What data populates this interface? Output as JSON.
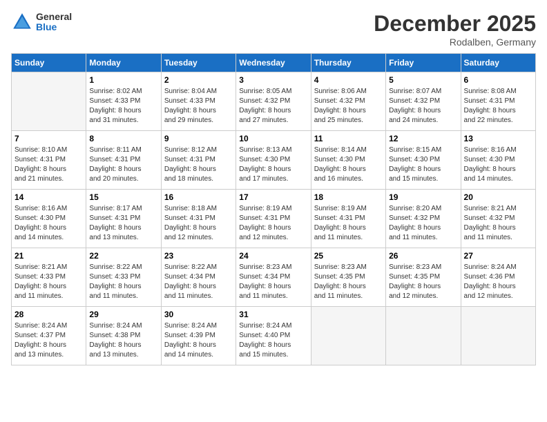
{
  "header": {
    "logo_general": "General",
    "logo_blue": "Blue",
    "month_title": "December 2025",
    "location": "Rodalben, Germany"
  },
  "days_of_week": [
    "Sunday",
    "Monday",
    "Tuesday",
    "Wednesday",
    "Thursday",
    "Friday",
    "Saturday"
  ],
  "weeks": [
    [
      {
        "day": "",
        "info": ""
      },
      {
        "day": "1",
        "info": "Sunrise: 8:02 AM\nSunset: 4:33 PM\nDaylight: 8 hours\nand 31 minutes."
      },
      {
        "day": "2",
        "info": "Sunrise: 8:04 AM\nSunset: 4:33 PM\nDaylight: 8 hours\nand 29 minutes."
      },
      {
        "day": "3",
        "info": "Sunrise: 8:05 AM\nSunset: 4:32 PM\nDaylight: 8 hours\nand 27 minutes."
      },
      {
        "day": "4",
        "info": "Sunrise: 8:06 AM\nSunset: 4:32 PM\nDaylight: 8 hours\nand 25 minutes."
      },
      {
        "day": "5",
        "info": "Sunrise: 8:07 AM\nSunset: 4:32 PM\nDaylight: 8 hours\nand 24 minutes."
      },
      {
        "day": "6",
        "info": "Sunrise: 8:08 AM\nSunset: 4:31 PM\nDaylight: 8 hours\nand 22 minutes."
      }
    ],
    [
      {
        "day": "7",
        "info": "Sunrise: 8:10 AM\nSunset: 4:31 PM\nDaylight: 8 hours\nand 21 minutes."
      },
      {
        "day": "8",
        "info": "Sunrise: 8:11 AM\nSunset: 4:31 PM\nDaylight: 8 hours\nand 20 minutes."
      },
      {
        "day": "9",
        "info": "Sunrise: 8:12 AM\nSunset: 4:31 PM\nDaylight: 8 hours\nand 18 minutes."
      },
      {
        "day": "10",
        "info": "Sunrise: 8:13 AM\nSunset: 4:30 PM\nDaylight: 8 hours\nand 17 minutes."
      },
      {
        "day": "11",
        "info": "Sunrise: 8:14 AM\nSunset: 4:30 PM\nDaylight: 8 hours\nand 16 minutes."
      },
      {
        "day": "12",
        "info": "Sunrise: 8:15 AM\nSunset: 4:30 PM\nDaylight: 8 hours\nand 15 minutes."
      },
      {
        "day": "13",
        "info": "Sunrise: 8:16 AM\nSunset: 4:30 PM\nDaylight: 8 hours\nand 14 minutes."
      }
    ],
    [
      {
        "day": "14",
        "info": "Sunrise: 8:16 AM\nSunset: 4:30 PM\nDaylight: 8 hours\nand 14 minutes."
      },
      {
        "day": "15",
        "info": "Sunrise: 8:17 AM\nSunset: 4:31 PM\nDaylight: 8 hours\nand 13 minutes."
      },
      {
        "day": "16",
        "info": "Sunrise: 8:18 AM\nSunset: 4:31 PM\nDaylight: 8 hours\nand 12 minutes."
      },
      {
        "day": "17",
        "info": "Sunrise: 8:19 AM\nSunset: 4:31 PM\nDaylight: 8 hours\nand 12 minutes."
      },
      {
        "day": "18",
        "info": "Sunrise: 8:19 AM\nSunset: 4:31 PM\nDaylight: 8 hours\nand 11 minutes."
      },
      {
        "day": "19",
        "info": "Sunrise: 8:20 AM\nSunset: 4:32 PM\nDaylight: 8 hours\nand 11 minutes."
      },
      {
        "day": "20",
        "info": "Sunrise: 8:21 AM\nSunset: 4:32 PM\nDaylight: 8 hours\nand 11 minutes."
      }
    ],
    [
      {
        "day": "21",
        "info": "Sunrise: 8:21 AM\nSunset: 4:33 PM\nDaylight: 8 hours\nand 11 minutes."
      },
      {
        "day": "22",
        "info": "Sunrise: 8:22 AM\nSunset: 4:33 PM\nDaylight: 8 hours\nand 11 minutes."
      },
      {
        "day": "23",
        "info": "Sunrise: 8:22 AM\nSunset: 4:34 PM\nDaylight: 8 hours\nand 11 minutes."
      },
      {
        "day": "24",
        "info": "Sunrise: 8:23 AM\nSunset: 4:34 PM\nDaylight: 8 hours\nand 11 minutes."
      },
      {
        "day": "25",
        "info": "Sunrise: 8:23 AM\nSunset: 4:35 PM\nDaylight: 8 hours\nand 11 minutes."
      },
      {
        "day": "26",
        "info": "Sunrise: 8:23 AM\nSunset: 4:35 PM\nDaylight: 8 hours\nand 12 minutes."
      },
      {
        "day": "27",
        "info": "Sunrise: 8:24 AM\nSunset: 4:36 PM\nDaylight: 8 hours\nand 12 minutes."
      }
    ],
    [
      {
        "day": "28",
        "info": "Sunrise: 8:24 AM\nSunset: 4:37 PM\nDaylight: 8 hours\nand 13 minutes."
      },
      {
        "day": "29",
        "info": "Sunrise: 8:24 AM\nSunset: 4:38 PM\nDaylight: 8 hours\nand 13 minutes."
      },
      {
        "day": "30",
        "info": "Sunrise: 8:24 AM\nSunset: 4:39 PM\nDaylight: 8 hours\nand 14 minutes."
      },
      {
        "day": "31",
        "info": "Sunrise: 8:24 AM\nSunset: 4:40 PM\nDaylight: 8 hours\nand 15 minutes."
      },
      {
        "day": "",
        "info": ""
      },
      {
        "day": "",
        "info": ""
      },
      {
        "day": "",
        "info": ""
      }
    ]
  ]
}
